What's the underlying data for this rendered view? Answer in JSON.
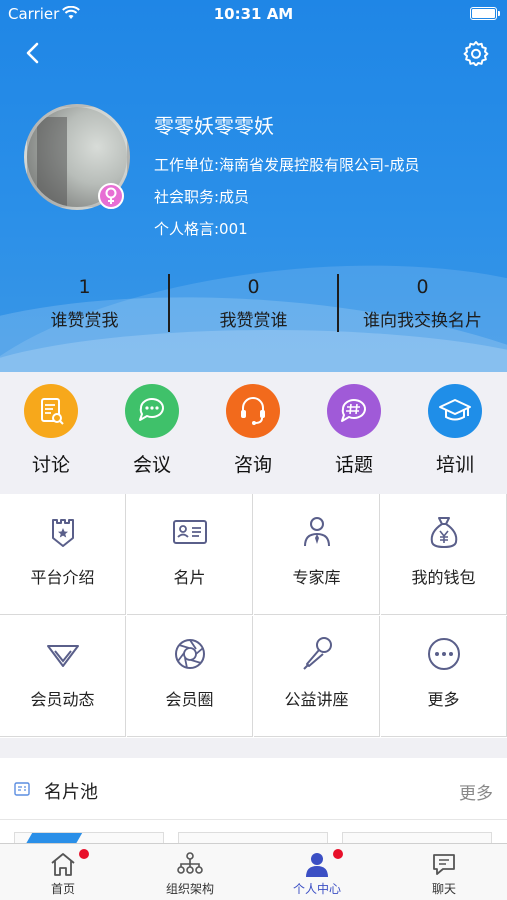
{
  "status_bar": {
    "carrier": "Carrier",
    "time": "10:31 AM"
  },
  "profile": {
    "name": "零零妖零零妖",
    "work_unit": "工作单位:海南省发展控股有限公司-成员",
    "social_role": "社会职务:成员",
    "motto": "个人格言:001",
    "gender": "female"
  },
  "stats": [
    {
      "value": "1",
      "label": "谁赞赏我"
    },
    {
      "value": "0",
      "label": "我赞赏谁"
    },
    {
      "value": "0",
      "label": "谁向我交换名片"
    }
  ],
  "quick_actions": [
    {
      "label": "讨论",
      "icon": "discussion-doc-icon",
      "color": "#f7a81b"
    },
    {
      "label": "会议",
      "icon": "chat-bubble-icon",
      "color": "#3fc16a"
    },
    {
      "label": "咨询",
      "icon": "headset-icon",
      "color": "#f26a1c"
    },
    {
      "label": "话题",
      "icon": "hashtag-icon",
      "color": "#a05ad8"
    },
    {
      "label": "培训",
      "icon": "graduation-cap-icon",
      "color": "#1f8ee8"
    }
  ],
  "grid_items": [
    {
      "label": "平台介绍",
      "icon": "badge-star-icon"
    },
    {
      "label": "名片",
      "icon": "id-card-icon"
    },
    {
      "label": "专家库",
      "icon": "expert-person-icon"
    },
    {
      "label": "我的钱包",
      "icon": "money-bag-icon"
    },
    {
      "label": "会员动态",
      "icon": "diamond-icon"
    },
    {
      "label": "会员圈",
      "icon": "aperture-icon"
    },
    {
      "label": "公益讲座",
      "icon": "microphone-icon"
    },
    {
      "label": "更多",
      "icon": "more-dots-icon"
    }
  ],
  "card_pool": {
    "title": "名片池",
    "more": "更多"
  },
  "tab_bar": [
    {
      "label": "首页",
      "icon": "home-icon",
      "badge": true,
      "active": false
    },
    {
      "label": "组织架构",
      "icon": "org-chart-icon",
      "badge": false,
      "active": false
    },
    {
      "label": "个人中心",
      "icon": "user-icon",
      "badge": true,
      "active": true
    },
    {
      "label": "聊天",
      "icon": "chat-icon",
      "badge": false,
      "active": false
    }
  ],
  "colors": {
    "header_blue": "#2a8fe8",
    "active_tab": "#3b4fc4",
    "badge_red": "#e8102a",
    "female_pink": "#e76fd4"
  }
}
